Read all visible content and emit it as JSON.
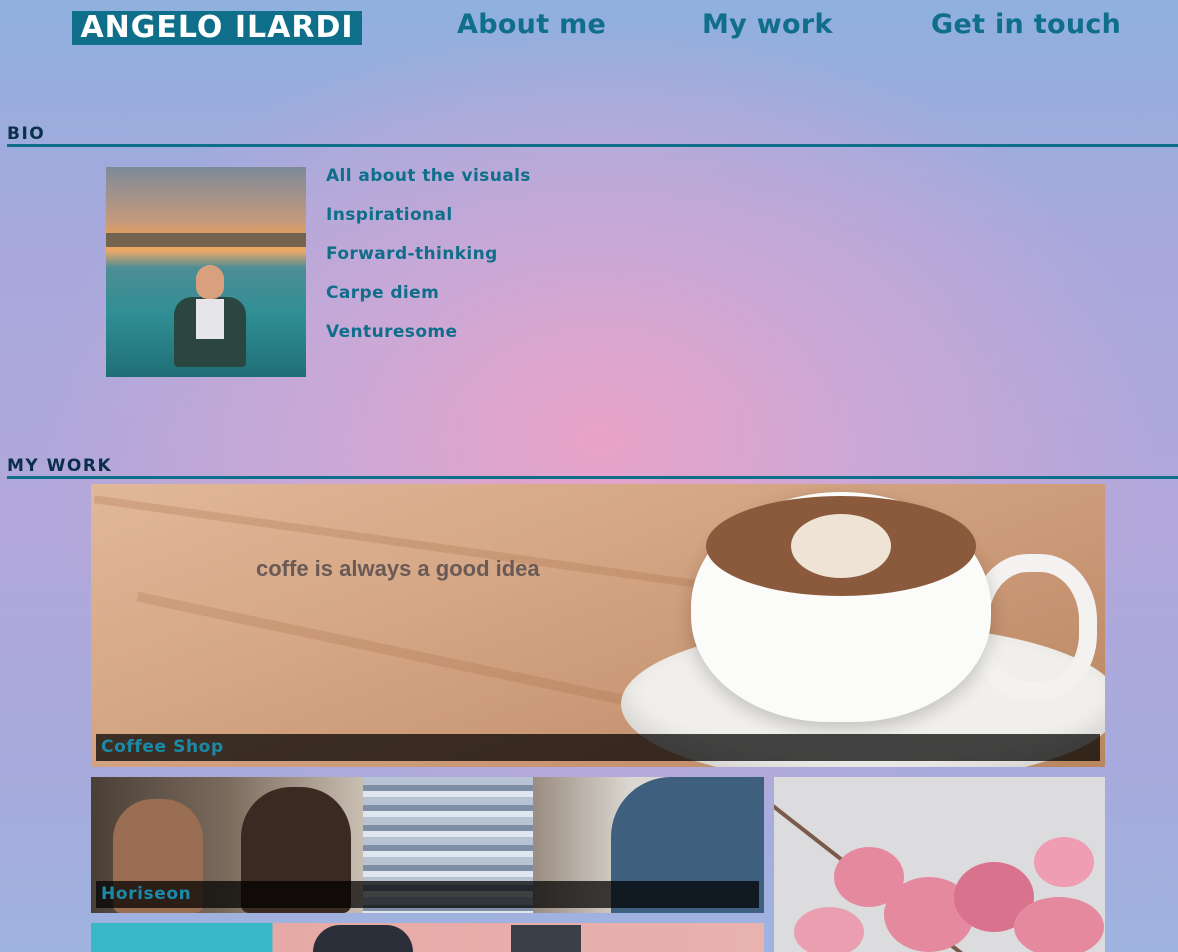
{
  "header": {
    "logo": "ANGELO ILARDI",
    "nav": {
      "about": "About me",
      "work": "My work",
      "contact": "Get in touch"
    }
  },
  "bio": {
    "heading": "BIO",
    "traits": [
      "All about the visuals",
      "Inspirational",
      "Forward-thinking",
      "Carpe diem",
      "Venturesome"
    ]
  },
  "work": {
    "heading": "MY WORK",
    "projects": [
      {
        "title": "Coffee Shop",
        "image_text": "coffe is always a good idea"
      },
      {
        "title": "Horiseon"
      }
    ]
  },
  "colors": {
    "accent": "#0f6e8a",
    "heading_text": "#0a2f4a",
    "label_text": "#1a8aa8",
    "background_pink": "#eca2c6",
    "background_blue": "#8fb0de"
  }
}
